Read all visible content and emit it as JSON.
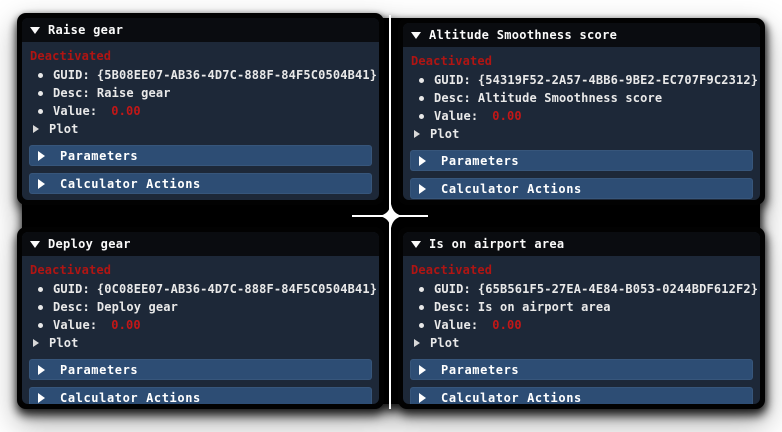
{
  "colors": {
    "page_bg": "#ffffff",
    "card_border": "#020202",
    "panel_bg": "#1d2838",
    "header_bg": "#0a0c10",
    "bar_bg": "#2d4d74",
    "status_red": "#b01513",
    "value_red": "#c21717",
    "text_light": "#e9e9e9"
  },
  "icons": {
    "collapse": "triangle-down",
    "expand": "triangle-right",
    "bullet": "filled-circle",
    "dock_center": "four-point-star"
  },
  "panels": [
    {
      "title": "Raise gear",
      "status": "Deactivated",
      "guid_label": "GUID:",
      "guid": "{5B08EE07-AB36-4D7C-888F-84F5C0504B41}",
      "desc_label": "Desc:",
      "desc": "Raise gear",
      "value_label": "Value:",
      "value": "0.00",
      "plot_label": "Plot",
      "parameters_label": "Parameters",
      "calculator_label": "Calculator Actions"
    },
    {
      "title": "Altitude Smoothness score",
      "status": "Deactivated",
      "guid_label": "GUID:",
      "guid": "{54319F52-2A57-4BB6-9BE2-EC707F9C2312}",
      "desc_label": "Desc:",
      "desc": "Altitude Smoothness score",
      "value_label": "Value:",
      "value": "0.00",
      "plot_label": "Plot",
      "parameters_label": "Parameters",
      "calculator_label": "Calculator Actions"
    },
    {
      "title": "Deploy gear",
      "status": "Deactivated",
      "guid_label": "GUID:",
      "guid": "{0C08EE07-AB36-4D7C-888F-84F5C0504B41}",
      "desc_label": "Desc:",
      "desc": "Deploy gear",
      "value_label": "Value:",
      "value": "0.00",
      "plot_label": "Plot",
      "parameters_label": "Parameters",
      "calculator_label": "Calculator Actions"
    },
    {
      "title": "Is on airport area",
      "status": "Deactivated",
      "guid_label": "GUID:",
      "guid": "{65B561F5-27EA-4E84-B053-0244BDF612F2}",
      "desc_label": "Desc:",
      "desc": "Is on airport area",
      "value_label": "Value:",
      "value": "0.00",
      "plot_label": "Plot",
      "parameters_label": "Parameters",
      "calculator_label": "Calculator Actions"
    }
  ]
}
